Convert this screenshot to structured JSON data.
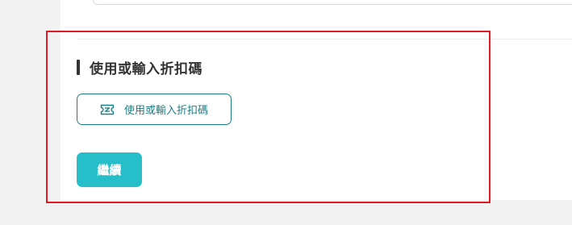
{
  "section": {
    "title": "使用或輸入折扣碼"
  },
  "coupon_button": {
    "label": "使用或輸入折扣碼",
    "icon": "ticket-icon"
  },
  "continue_button": {
    "label": "繼續"
  },
  "colors": {
    "accent_teal": "#26bfc9",
    "outline_teal": "#1a7f84",
    "highlight_red": "#e01b24"
  }
}
